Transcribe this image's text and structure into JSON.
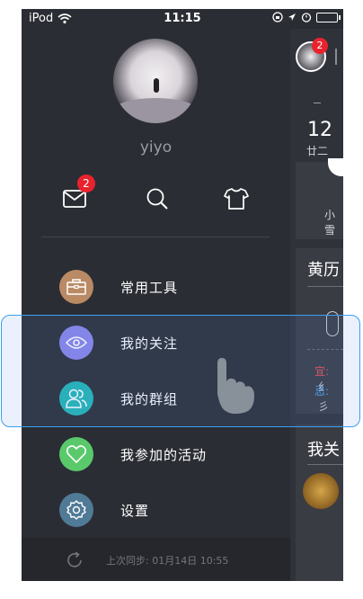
{
  "status_bar": {
    "carrier": "iPod",
    "time": "11:15"
  },
  "profile": {
    "username": "yiyo"
  },
  "quick_actions": {
    "mail_badge": "2"
  },
  "menu": [
    {
      "label": "常用工具",
      "icon": "toolbox-icon",
      "color": "#b98a64"
    },
    {
      "label": "我的关注",
      "icon": "eye-icon",
      "color": "#8a83e8"
    },
    {
      "label": "我的群组",
      "icon": "group-icon",
      "color": "#23b5b5"
    },
    {
      "label": "我参加的活动",
      "icon": "heart-icon",
      "color": "#5ac96b"
    },
    {
      "label": "设置",
      "icon": "gear-icon",
      "color": "#507a96"
    }
  ],
  "sync": {
    "text": "上次同步: 01月14日 10:55"
  },
  "panel": {
    "badge": "2",
    "date_number": "12",
    "date_lunar": "廿二",
    "card1_text": "小雪",
    "section1_title": "黄历",
    "yi_label": "宜:",
    "yi_value": "纟",
    "ji_label": "忌:",
    "ji_value": "彡",
    "section2_title": "我关"
  },
  "colors": {
    "drawer_bg": "#2b2d34",
    "highlight": "#3a9fef",
    "badge": "#e8232d"
  }
}
